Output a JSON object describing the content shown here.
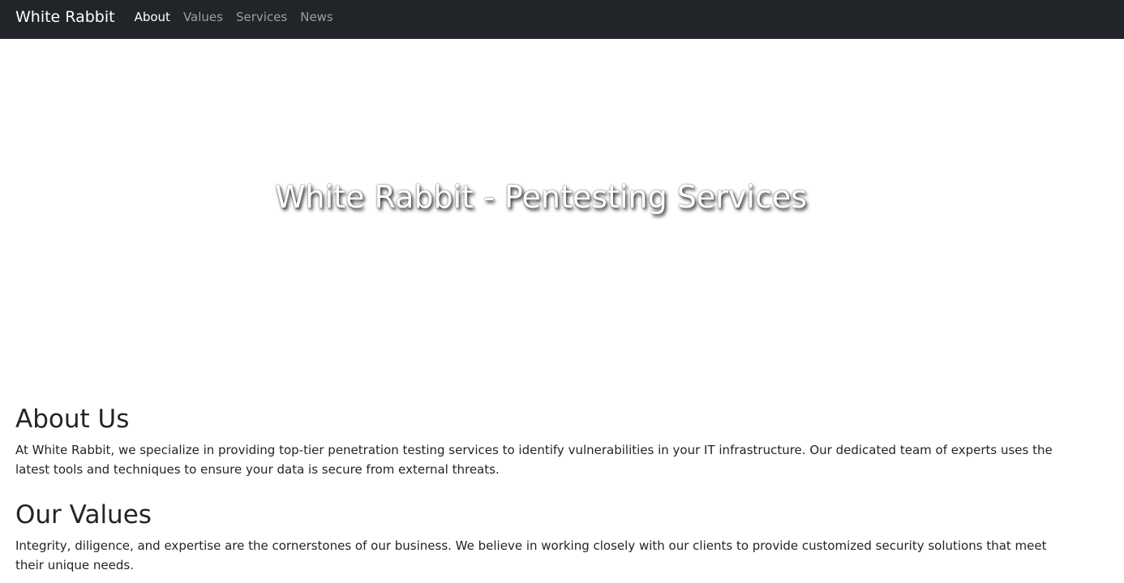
{
  "navbar": {
    "brand": "White Rabbit",
    "links": [
      {
        "label": "About",
        "active": true
      },
      {
        "label": "Values",
        "active": false
      },
      {
        "label": "Services",
        "active": false
      },
      {
        "label": "News",
        "active": false
      }
    ]
  },
  "hero": {
    "title": "White Rabbit - Pentesting Services"
  },
  "about": {
    "heading": "About Us",
    "text": "At White Rabbit, we specialize in providing top-tier penetration testing services to identify vulnerabilities in your IT infrastructure. Our dedicated team of experts uses the latest tools and techniques to ensure your data is secure from external threats."
  },
  "values": {
    "heading": "Our Values",
    "text": "Integrity, diligence, and expertise are the cornerstones of our business. We believe in working closely with our clients to provide customized security solutions that meet their unique needs."
  },
  "colors": {
    "navbar_bg": "#212529",
    "nav_active": "#ffffff",
    "nav_inactive": "#8c8f92"
  }
}
